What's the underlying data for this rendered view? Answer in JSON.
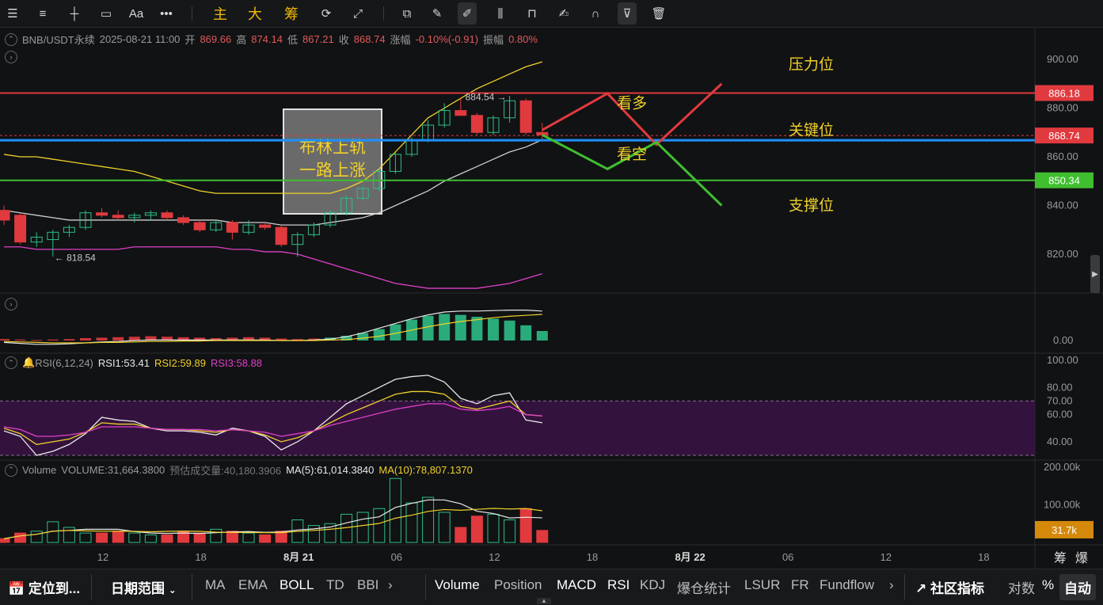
{
  "toolbar": {
    "icons": [
      "list-icon",
      "lines-icon",
      "horizontal-line-icon",
      "rectangle-icon"
    ],
    "font_label": "Aa",
    "more_label": "•••",
    "zhu": "主",
    "da": "大",
    "chou": "筹",
    "right_icons": [
      "copy-icon",
      "pen-icon",
      "brush-icon",
      "candle-settings-icon",
      "lock-icon",
      "edit-icon",
      "magnet-icon",
      "filter-icon",
      "trash-icon"
    ]
  },
  "header": {
    "symbol": "BNB/USDT永续",
    "datetime": "2025-08-21 11:00",
    "open_label": "开",
    "open": "869.66",
    "high_label": "高",
    "high": "874.14",
    "low_label": "低",
    "low": "867.21",
    "close_label": "收",
    "close": "868.74",
    "change_label": "涨幅",
    "change": "-0.10%(-0.91)",
    "amp_label": "振幅",
    "amp": "0.80%"
  },
  "rsi_header": {
    "label": "RSI(6,12,24)",
    "rsi1": "RSI1:53.41",
    "rsi2": "RSI2:59.89",
    "rsi3": "RSI3:58.88"
  },
  "vol_header": {
    "label": "Volume",
    "volume": "VOLUME:31,664.3800",
    "est_label": "预估成交量:40,180.3906",
    "ma5": "MA(5):61,014.3840",
    "ma10": "MA(10):78,807.1370"
  },
  "chart_data": {
    "type": "candlestick",
    "price_axis": [
      "900.00",
      "880.00",
      "860.00",
      "840.00",
      "820.00"
    ],
    "price_range": [
      814,
      902
    ],
    "markers": {
      "high": "884.54 →",
      "low": "← 818.54"
    },
    "badges": {
      "resistance": "886.18",
      "current": "868.74",
      "support": "850.34"
    },
    "annotations": {
      "pressure": "压力位",
      "key": "关键位",
      "support": "支撑位",
      "bull": "看多",
      "bear": "看空",
      "boll_note_1": "布林上轨",
      "boll_note_2": "一路上涨"
    },
    "candles": [
      {
        "o": 838,
        "h": 840,
        "l": 832,
        "c": 834
      },
      {
        "o": 836,
        "h": 837,
        "l": 824,
        "c": 825
      },
      {
        "o": 825,
        "h": 829,
        "l": 823,
        "c": 827
      },
      {
        "o": 826,
        "h": 830,
        "l": 819,
        "c": 829
      },
      {
        "o": 829,
        "h": 832,
        "l": 827,
        "c": 831
      },
      {
        "o": 831,
        "h": 838,
        "l": 830,
        "c": 837
      },
      {
        "o": 837,
        "h": 839,
        "l": 835,
        "c": 836
      },
      {
        "o": 836,
        "h": 838,
        "l": 834,
        "c": 835
      },
      {
        "o": 835,
        "h": 837,
        "l": 833,
        "c": 836
      },
      {
        "o": 836,
        "h": 838,
        "l": 834,
        "c": 837
      },
      {
        "o": 837,
        "h": 838,
        "l": 834,
        "c": 835
      },
      {
        "o": 835,
        "h": 836,
        "l": 832,
        "c": 833
      },
      {
        "o": 833,
        "h": 834,
        "l": 829,
        "c": 830
      },
      {
        "o": 830,
        "h": 834,
        "l": 829,
        "c": 833
      },
      {
        "o": 833,
        "h": 834,
        "l": 826,
        "c": 829
      },
      {
        "o": 829,
        "h": 834,
        "l": 828,
        "c": 832
      },
      {
        "o": 832,
        "h": 833,
        "l": 830,
        "c": 831
      },
      {
        "o": 831,
        "h": 832,
        "l": 823,
        "c": 824
      },
      {
        "o": 824,
        "h": 829,
        "l": 819,
        "c": 828
      },
      {
        "o": 828,
        "h": 833,
        "l": 827,
        "c": 832
      },
      {
        "o": 832,
        "h": 838,
        "l": 831,
        "c": 837
      },
      {
        "o": 837,
        "h": 844,
        "l": 836,
        "c": 843
      },
      {
        "o": 843,
        "h": 848,
        "l": 842,
        "c": 847
      },
      {
        "o": 847,
        "h": 855,
        "l": 846,
        "c": 854
      },
      {
        "o": 854,
        "h": 862,
        "l": 853,
        "c": 861
      },
      {
        "o": 861,
        "h": 868,
        "l": 860,
        "c": 867
      },
      {
        "o": 867,
        "h": 875,
        "l": 866,
        "c": 873
      },
      {
        "o": 873,
        "h": 882,
        "l": 872,
        "c": 879
      },
      {
        "o": 879,
        "h": 884,
        "l": 877,
        "c": 877
      },
      {
        "o": 877,
        "h": 878,
        "l": 869,
        "c": 870
      },
      {
        "o": 870,
        "h": 877,
        "l": 869,
        "c": 876
      },
      {
        "o": 876,
        "h": 885,
        "l": 874,
        "c": 883
      },
      {
        "o": 883,
        "h": 884,
        "l": 869,
        "c": 870
      },
      {
        "o": 870,
        "h": 874,
        "l": 867,
        "c": 869
      }
    ],
    "boll_upper": [
      861,
      860,
      860,
      859,
      858,
      857,
      856,
      855,
      854,
      852,
      850,
      848,
      846,
      845,
      845,
      845,
      845,
      845,
      845,
      845,
      845,
      847,
      850,
      855,
      862,
      869,
      876,
      880,
      884,
      888,
      891,
      894,
      897,
      899
    ],
    "boll_mid": [
      838,
      837,
      836,
      835,
      834,
      834,
      834,
      834,
      834,
      834,
      834,
      834,
      834,
      834,
      833,
      833,
      833,
      832,
      832,
      832,
      833,
      834,
      835,
      837,
      840,
      843,
      846,
      850,
      853,
      856,
      859,
      862,
      864,
      867
    ],
    "boll_lower": [
      823,
      823,
      822,
      822,
      822,
      822,
      822,
      822,
      823,
      823,
      823,
      823,
      823,
      823,
      822,
      822,
      821,
      821,
      820,
      818,
      816,
      814,
      812,
      810,
      808,
      807,
      806,
      806,
      806,
      806,
      807,
      808,
      810,
      812
    ],
    "macd_hist": [
      0.3,
      0.2,
      0.1,
      0.2,
      0.3,
      0.5,
      0.6,
      0.7,
      0.8,
      0.9,
      0.8,
      0.7,
      0.6,
      0.5,
      0.6,
      0.7,
      0.6,
      0.4,
      0.3,
      0.4,
      0.6,
      1.0,
      1.6,
      2.4,
      3.4,
      4.4,
      5.2,
      5.6,
      5.4,
      5.0,
      4.6,
      4.2,
      3.2,
      2.0
    ],
    "macd_dif": [
      -0.4,
      -0.6,
      -0.8,
      -0.8,
      -0.7,
      -0.5,
      -0.3,
      -0.2,
      0,
      0.1,
      0.1,
      0.1,
      0.1,
      0.1,
      0.1,
      0.1,
      0.1,
      0,
      0,
      0.1,
      0.3,
      0.8,
      1.6,
      2.6,
      3.6,
      4.6,
      5.4,
      6.0,
      6.2,
      6.2,
      6.3,
      6.4,
      6.4,
      6.2
    ],
    "macd_dea": [
      -0.2,
      -0.3,
      -0.4,
      -0.5,
      -0.5,
      -0.5,
      -0.4,
      -0.4,
      -0.3,
      -0.2,
      -0.2,
      -0.1,
      -0.1,
      0,
      0,
      0,
      0,
      0,
      0,
      0,
      0.1,
      0.2,
      0.5,
      0.9,
      1.5,
      2.2,
      2.9,
      3.5,
      4.0,
      4.4,
      4.8,
      5.1,
      5.3,
      5.5
    ],
    "rsi1": [
      48,
      44,
      30,
      33,
      38,
      46,
      58,
      56,
      55,
      50,
      48,
      48,
      47,
      45,
      50,
      48,
      44,
      34,
      40,
      48,
      58,
      68,
      74,
      80,
      86,
      88,
      89,
      84,
      72,
      68,
      74,
      76,
      56,
      54
    ],
    "rsi2": [
      50,
      46,
      38,
      40,
      42,
      47,
      54,
      53,
      53,
      50,
      49,
      49,
      48,
      47,
      49,
      48,
      45,
      40,
      43,
      48,
      54,
      60,
      65,
      70,
      75,
      77,
      77,
      75,
      66,
      64,
      67,
      70,
      60,
      59
    ],
    "rsi3": [
      51,
      49,
      44,
      44,
      45,
      47,
      51,
      51,
      51,
      50,
      49,
      49,
      49,
      48,
      49,
      48,
      47,
      44,
      46,
      48,
      52,
      55,
      58,
      61,
      64,
      66,
      68,
      68,
      64,
      63,
      64,
      66,
      60,
      59
    ],
    "rsi_axis": [
      "100.00",
      "80.00",
      "70.00",
      "60.00",
      "40.00"
    ],
    "volumes": [
      10,
      25,
      30,
      55,
      40,
      25,
      25,
      30,
      25,
      20,
      20,
      30,
      25,
      35,
      30,
      25,
      20,
      30,
      60,
      45,
      50,
      75,
      80,
      90,
      170,
      105,
      120,
      80,
      40,
      70,
      75,
      60,
      90,
      32
    ],
    "vol_axis": [
      "200.00k",
      "100.00k"
    ],
    "vol_badge": "31.7k",
    "macd_axis": "0.00",
    "time_axis": [
      {
        "label": "12"
      },
      {
        "label": "18"
      },
      {
        "label": "8月 21",
        "bold": true
      },
      {
        "label": "06"
      },
      {
        "label": "12"
      },
      {
        "label": "18"
      },
      {
        "label": "8月 22",
        "bold": true
      },
      {
        "label": "06"
      },
      {
        "label": "12"
      },
      {
        "label": "18"
      }
    ],
    "bottom_right_labels": [
      "筹",
      "爆"
    ]
  },
  "bottombar": {
    "locate": "定位到...",
    "date_range": "日期范围",
    "indicators_left": [
      "MA",
      "EMA",
      "BOLL",
      "TD",
      "BBI"
    ],
    "indicators_right": [
      "Volume",
      "Position",
      "MACD",
      "RSI",
      "KDJ",
      "爆仓统计",
      "LSUR",
      "FR",
      "Fundflow"
    ],
    "community": "社区指标",
    "log": "对数",
    "percent": "%",
    "auto": "自动"
  },
  "colors": {
    "red": "#e03a3e",
    "green": "#2ebd85",
    "blue": "#1e90ff",
    "yellow": "#f0d12a",
    "pink": "#e040c9",
    "accent": "#f0b90b"
  }
}
